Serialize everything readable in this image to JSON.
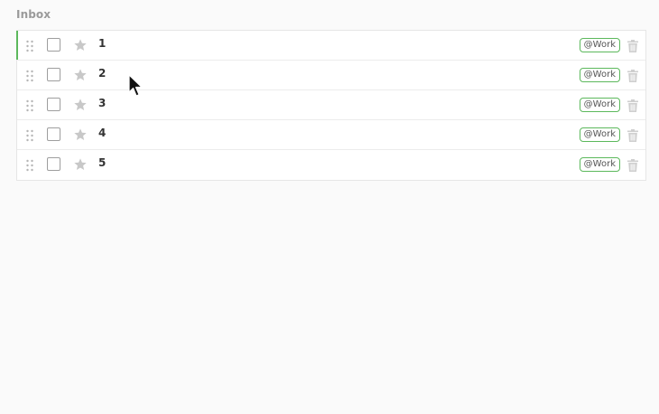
{
  "section": {
    "title": "Inbox"
  },
  "tasks": [
    {
      "title": "1",
      "tag": "@Work",
      "active": true
    },
    {
      "title": "2",
      "tag": "@Work",
      "active": false
    },
    {
      "title": "3",
      "tag": "@Work",
      "active": false
    },
    {
      "title": "4",
      "tag": "@Work",
      "active": false
    },
    {
      "title": "5",
      "tag": "@Work",
      "active": false
    }
  ],
  "icons": {
    "drag": "drag-handle-icon",
    "star": "star-icon",
    "trash": "trash-icon",
    "cursor": "mouse-cursor-icon"
  },
  "colors": {
    "accent": "#5cb85c",
    "star": "#c8c8c8",
    "trash": "#cfcfcf"
  }
}
